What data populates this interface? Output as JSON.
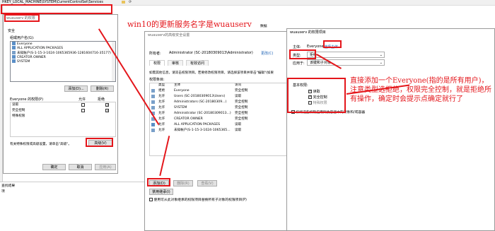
{
  "regedit": {
    "address": "HKEY_LOCAL_MACHINE\\SYSTEM\\CurrentControlSet\\Services",
    "col_data": "数据",
    "status_find": "查找结果",
    "status_item": "项"
  },
  "perm_dialog": {
    "title": "wuauserv 的权限",
    "security_tab": "安全",
    "group_label": "组或用户名(G):",
    "users": [
      "Everyone",
      "ALL APPLICATION PACKAGES",
      "未知账户(S-1-15-3-1024-1065365936-1281604716-35177)",
      "CREATOR OWNER",
      "SYSTEM"
    ],
    "add_btn": "添加(D)...",
    "remove_btn": "删除(R)",
    "perm_for": "Everyone 的权限(P)",
    "allow_col": "允许",
    "deny_col": "拒绝",
    "perms": [
      {
        "name": "读取",
        "allow": false,
        "deny": true
      },
      {
        "name": "完全控制",
        "allow": false,
        "deny": true
      },
      {
        "name": "特殊权限",
        "allow": false,
        "deny": false
      }
    ],
    "special_text": "有关特殊权限或高级设置，请单击\"高级\"。",
    "advanced_btn": "高级(V)",
    "ok_btn": "确定",
    "cancel_btn": "取消",
    "apply_btn": "应用(A)"
  },
  "adv_dialog": {
    "title": "wuauserv的高级安全设置",
    "owner_label": "所有者:",
    "owner_value": "Administrator (SC-20180309013\\Administrator)",
    "change_link": "更改(C)",
    "tabs": [
      "权限",
      "审核",
      "有效访问"
    ],
    "info_text": "如需其他信息，请双击权限项目。若要修改权限项目，请选择该项目并单击\"编辑\"(如果",
    "entries_label": "权限条目:",
    "headers": [
      "类型",
      "主体",
      "访问",
      "继承"
    ],
    "rows": [
      {
        "type": "拒绝",
        "principal": "Everyone",
        "access": "完全控制",
        "inherit": "无"
      },
      {
        "type": "允许",
        "principal": "Users (SC-20180309013\\Users)",
        "access": "读取",
        "inherit": "父对"
      },
      {
        "type": "允许",
        "principal": "Administrators (SC-20180309...)",
        "access": "完全控制",
        "inherit": "父对"
      },
      {
        "type": "允许",
        "principal": "SYSTEM",
        "access": "完全控制",
        "inherit": "父对"
      },
      {
        "type": "允许",
        "principal": "Administrator (SC-20180309013...)",
        "access": "完全控制",
        "inherit": "父对"
      },
      {
        "type": "允许",
        "principal": "CREATOR OWNER",
        "access": "完全控制",
        "inherit": "父对"
      },
      {
        "type": "允许",
        "principal": "ALL APPLICATION PACKAGES",
        "access": "读取",
        "inherit": "父对"
      },
      {
        "type": "允许",
        "principal": "未知帐户(S-1-15-3-1024-1065365...",
        "access": "读取",
        "inherit": "父对"
      }
    ],
    "add_btn": "添加(D)",
    "remove_btn": "删除(R)",
    "view_btn": "查看(V)",
    "disable_btn": "禁用继承(I)",
    "replace_text": "使用可从此对象继承的权限项目替换所有子对象的权限项目(P)"
  },
  "entry_dialog": {
    "title": "wuauserv 的权限项目",
    "principal_label": "主体:",
    "principal_value": "Everyone",
    "select_link": "选择主体",
    "type_label": "类型:",
    "type_value": "拒绝",
    "applies_label": "应用于:",
    "applies_value": "该键和子对象",
    "basic_perm": "基本权限:",
    "perms": [
      {
        "name": "读取",
        "checked": true
      },
      {
        "name": "完全控制",
        "checked": true
      },
      {
        "name": "特殊权限",
        "checked": true
      }
    ],
    "only_apply": "仅将这些权限应用到此容器中的对象和/或容器"
  },
  "annotations": {
    "top": "win10的更新服务名字是wuauserv",
    "side": "直接添加一个Everyone(指的是所有用户)，注意类型选拒绝，权限完全控制，就是拒绝所有操作，确定时会提示点确定就行了"
  }
}
